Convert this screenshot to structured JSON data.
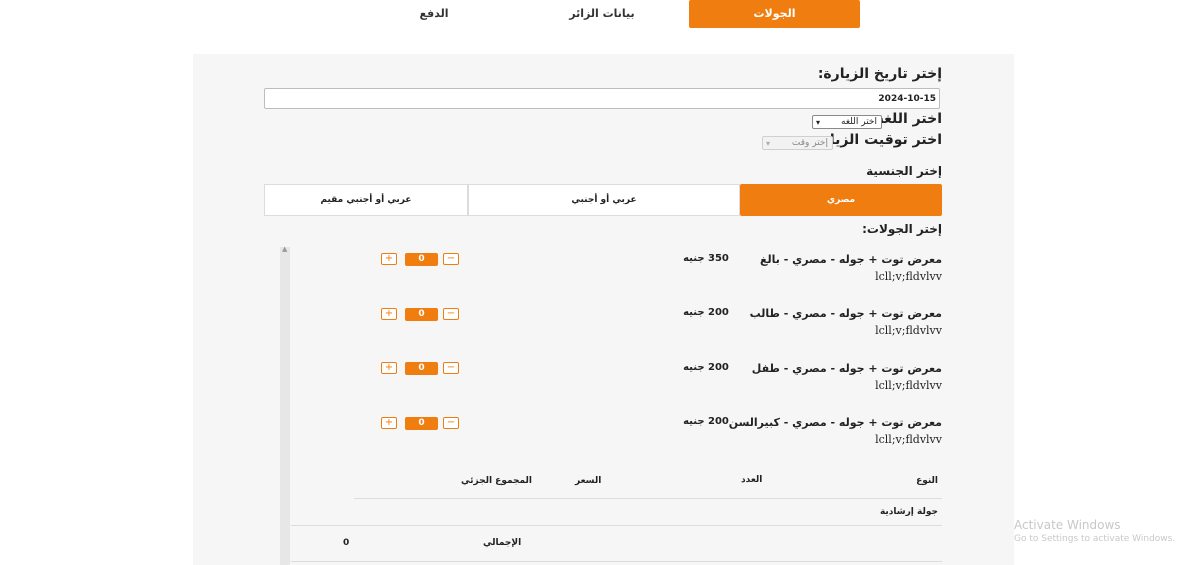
{
  "steps": {
    "tours": "الجولات",
    "visitor_data": "بيانات الزائر",
    "payment": "الدفع"
  },
  "form": {
    "date_label": "إختر تاريخ الزيارة:",
    "date_value": "2024-10-15",
    "language_label": "اختر اللغة :",
    "language_value": "اختر اللغه",
    "time_label": "اختر توقيت الزيارة :",
    "time_value": "إختر وقت",
    "nationality_label": "إختر الجنسية",
    "nationalities": [
      "مصري",
      "عربي أو أجنبي",
      "عربي أو أجنبي مقيم"
    ],
    "tours_label": "إختر الجولات:"
  },
  "tours": [
    {
      "name": "معرض توت + جوله - مصري - بالغ",
      "code": "lcll;v;fldvlvv",
      "price": "350 جنيه",
      "qty": "0"
    },
    {
      "name": "معرض توت + جوله - مصري - طالب",
      "code": "lcll;v;fldvlvv",
      "price": "200 جنيه",
      "qty": "0"
    },
    {
      "name": "معرض توت + جوله - مصري - طفل",
      "code": "lcll;v;fldvlvv",
      "price": "200 جنيه",
      "qty": "0"
    },
    {
      "name": "معرض توت + جوله - مصري - كبيرالسن",
      "code": "lcll;v;fldvlvv",
      "price": "200 جنيه",
      "qty": "0"
    }
  ],
  "summary": {
    "headers": {
      "type": "النوع",
      "count": "العدد",
      "price": "السعر",
      "subtotal": "المجموع الجزئي"
    },
    "guided_tour": "جولة إرشادية",
    "total_label": "الإجمالي",
    "total_value": "0"
  },
  "icons": {
    "plus": "+",
    "minus": "−",
    "caret": "▾"
  },
  "colors": {
    "accent": "#ef7d10"
  },
  "watermark": {
    "line1": "Activate Windows",
    "line2": "Go to Settings to activate Windows."
  }
}
